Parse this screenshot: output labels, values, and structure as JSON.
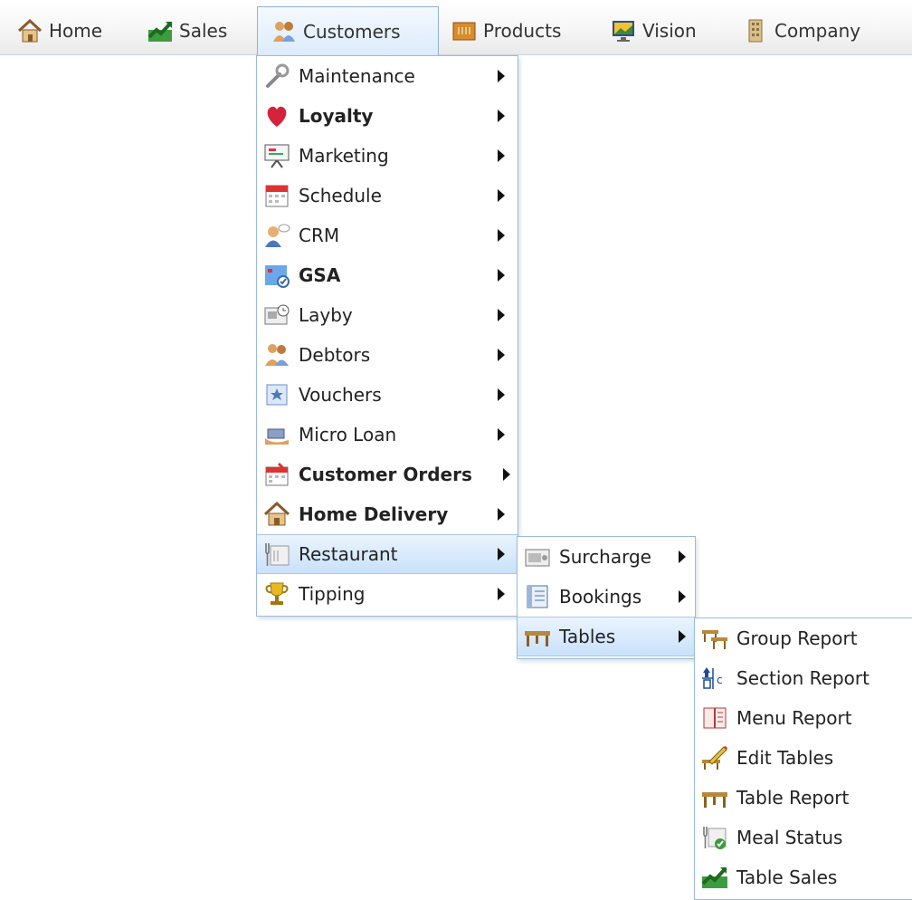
{
  "nav": {
    "items": [
      {
        "label": "Home",
        "icon": "house-icon"
      },
      {
        "label": "Sales",
        "icon": "sales-chart-icon"
      },
      {
        "label": "Customers",
        "icon": "customers-icon",
        "active": true
      },
      {
        "label": "Products",
        "icon": "products-box-icon"
      },
      {
        "label": "Vision",
        "icon": "monitor-icon"
      },
      {
        "label": "Company",
        "icon": "building-icon"
      }
    ]
  },
  "customers_menu": {
    "items": [
      {
        "label": "Maintenance",
        "icon": "wrench-icon",
        "bold": false
      },
      {
        "label": "Loyalty",
        "icon": "heart-icon",
        "bold": true
      },
      {
        "label": "Marketing",
        "icon": "presentation-icon",
        "bold": false
      },
      {
        "label": "Schedule",
        "icon": "calendar-icon",
        "bold": false
      },
      {
        "label": "CRM",
        "icon": "person-speech-icon",
        "bold": false
      },
      {
        "label": "GSA",
        "icon": "gsa-map-icon",
        "bold": true
      },
      {
        "label": "Layby",
        "icon": "layby-clock-icon",
        "bold": false
      },
      {
        "label": "Debtors",
        "icon": "debtors-people-icon",
        "bold": false
      },
      {
        "label": "Vouchers",
        "icon": "voucher-icon",
        "bold": false
      },
      {
        "label": "Micro Loan",
        "icon": "money-hand-icon",
        "bold": false
      },
      {
        "label": "Customer Orders",
        "icon": "order-calendar-icon",
        "bold": true
      },
      {
        "label": "Home Delivery",
        "icon": "delivery-house-icon",
        "bold": true
      },
      {
        "label": "Restaurant",
        "icon": "cutlery-icon",
        "bold": false,
        "highlighted": true
      },
      {
        "label": "Tipping",
        "icon": "trophy-icon",
        "bold": false
      }
    ]
  },
  "restaurant_menu": {
    "items": [
      {
        "label": "Surcharge",
        "icon": "surcharge-cash-icon"
      },
      {
        "label": "Bookings",
        "icon": "book-icon"
      },
      {
        "label": "Tables",
        "icon": "table-icon",
        "highlighted": true
      }
    ]
  },
  "tables_menu": {
    "items": [
      {
        "label": "Group Report",
        "icon": "table-group-icon"
      },
      {
        "label": "Section Report",
        "icon": "section-sort-icon"
      },
      {
        "label": "Menu Report",
        "icon": "menu-book-icon"
      },
      {
        "label": "Edit Tables",
        "icon": "edit-table-icon"
      },
      {
        "label": "Table Report",
        "icon": "table-icon"
      },
      {
        "label": "Meal Status",
        "icon": "meal-status-icon"
      },
      {
        "label": "Table Sales",
        "icon": "sales-chart-icon"
      }
    ]
  }
}
